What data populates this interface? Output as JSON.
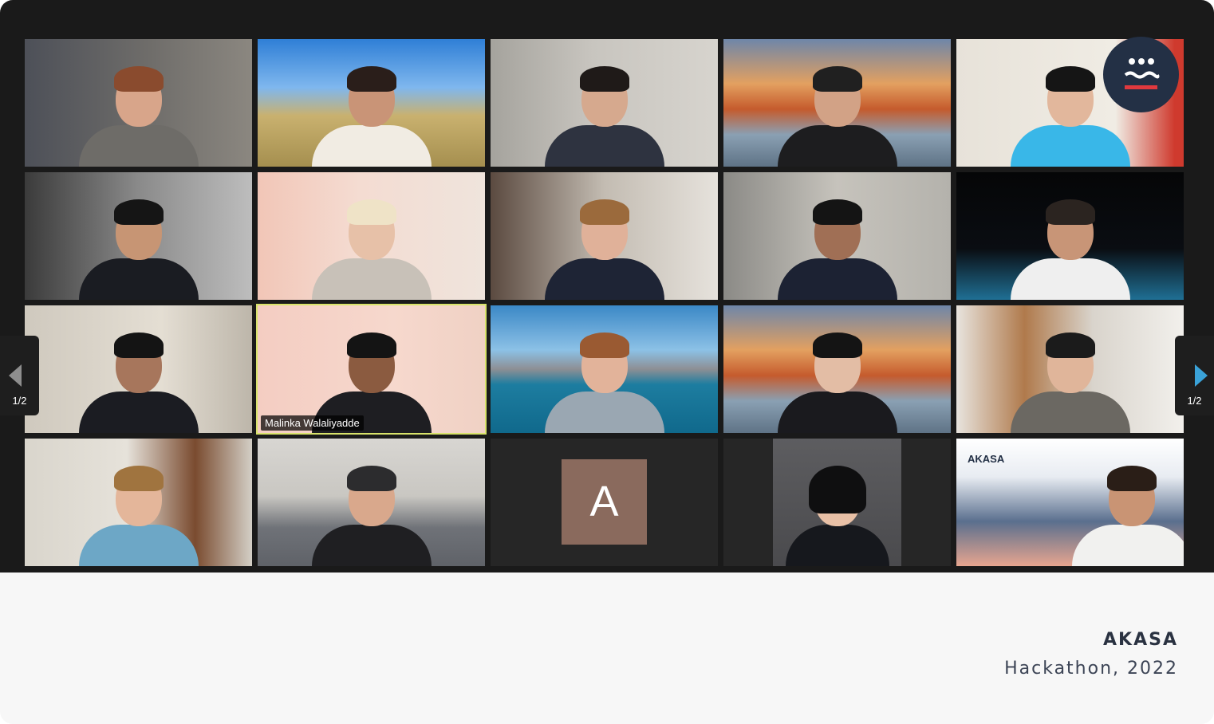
{
  "caption": {
    "company": "AKASA",
    "event": "Hackathon, 2022"
  },
  "pagination": {
    "left_page": "1/2",
    "right_page": "1/2"
  },
  "active_speaker": {
    "name": "Malinka Walaliyadde"
  },
  "avatar_tile": {
    "letter": "A"
  },
  "brand_background": {
    "text": "AKASA"
  },
  "colors": {
    "meeting_bg": "#1a1a1a",
    "speaker_highlight": "#d8e36a",
    "nav_arrow": "#3aa2d8",
    "brand": "#233045",
    "logo_accent": "#e0393e"
  },
  "icons": {
    "prev_page": "chevron-left-icon",
    "next_page": "chevron-right-icon",
    "logo": "akasa-robot-logo-icon"
  }
}
